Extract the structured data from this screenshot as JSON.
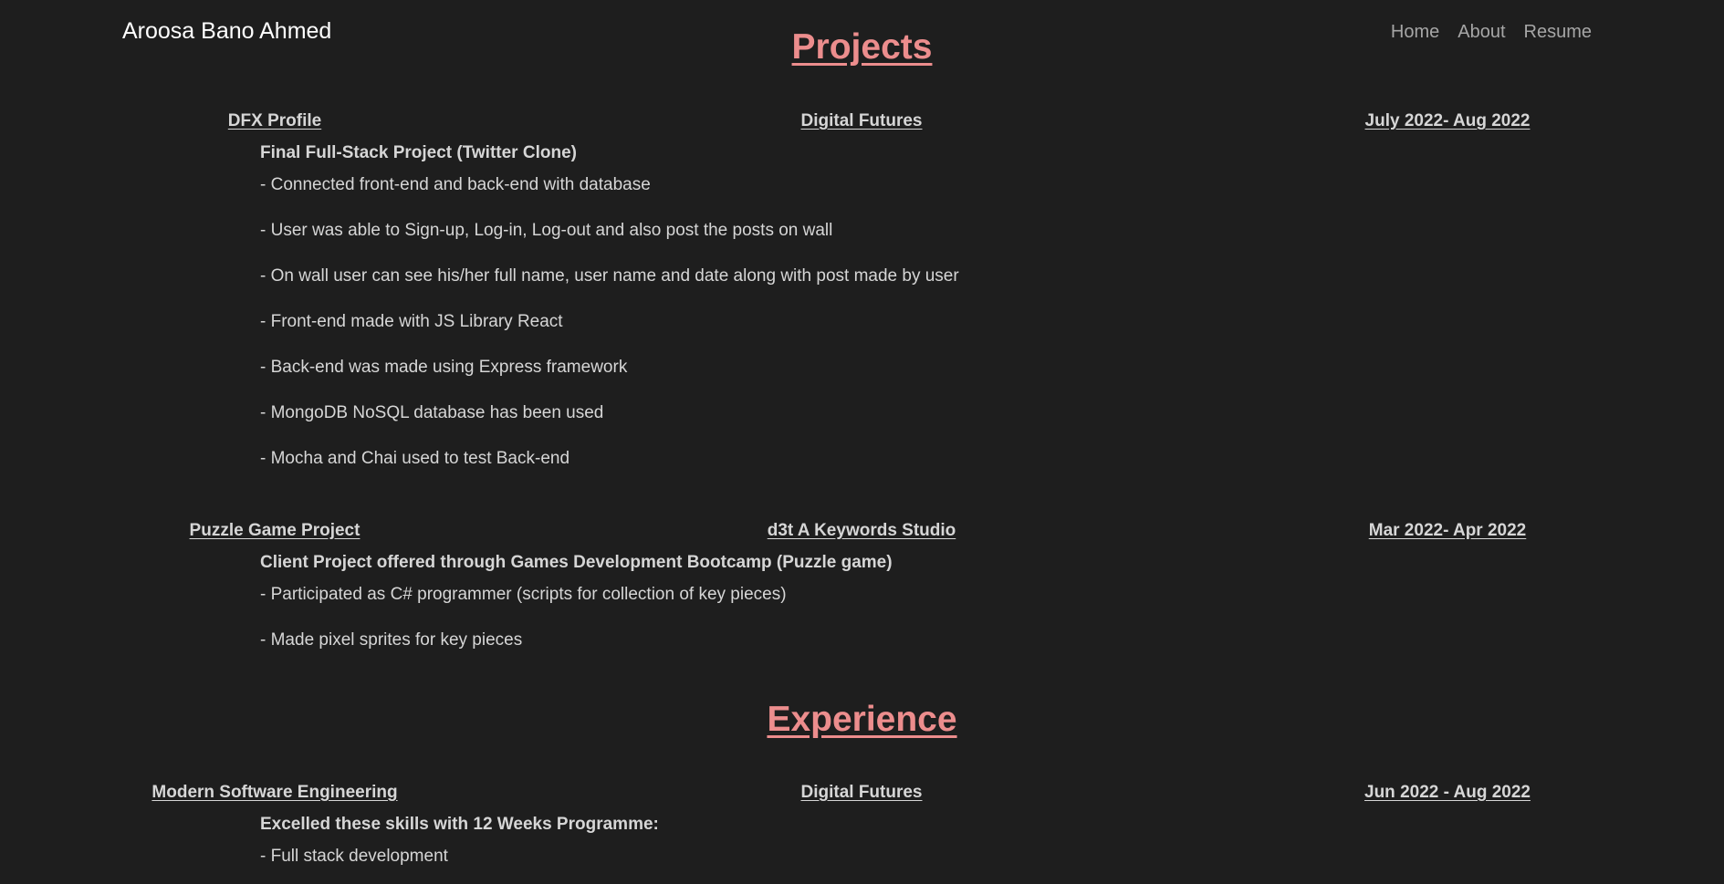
{
  "navbar": {
    "brand": "Aroosa Bano Ahmed",
    "links": [
      "Home",
      "About",
      "Resume"
    ]
  },
  "sections": {
    "projects": {
      "title": "Projects",
      "entries": [
        {
          "name": "DFX Profile",
          "org": "Digital Futures",
          "dates": "July 2022- Aug 2022",
          "subtitle": "Final Full-Stack Project (Twitter Clone)",
          "bullets": [
            "- Connected front-end and back-end with database",
            "- User was able to Sign-up, Log-in, Log-out and also post the posts on wall",
            "- On wall user can see his/her full name, user name and date along with post made by user",
            "- Front-end made with JS Library React",
            "- Back-end was made using Express framework",
            "- MongoDB NoSQL database has been used",
            "- Mocha and Chai used to test Back-end"
          ]
        },
        {
          "name": "Puzzle Game Project",
          "org": "d3t A Keywords Studio",
          "dates": "Mar 2022- Apr 2022",
          "subtitle": "Client Project offered through Games Development Bootcamp (Puzzle game)",
          "bullets": [
            "- Participated as C# programmer (scripts for collection of key pieces)",
            "- Made pixel sprites for key pieces"
          ]
        }
      ]
    },
    "experience": {
      "title": "Experience",
      "entries": [
        {
          "name": "Modern Software Engineering",
          "org": "Digital Futures",
          "dates": "Jun 2022 - Aug 2022",
          "subtitle": "Excelled these skills with 12 Weeks Programme:",
          "bullets": [
            "- Full stack development"
          ]
        }
      ]
    }
  }
}
